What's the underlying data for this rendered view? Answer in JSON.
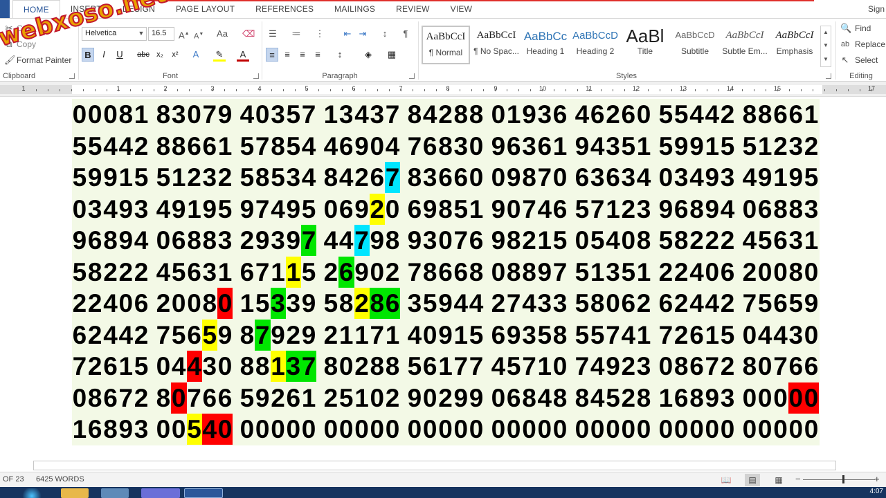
{
  "tabs": [
    "HOME",
    "INSERT",
    "DESIGN",
    "PAGE LAYOUT",
    "REFERENCES",
    "MAILINGS",
    "REVIEW",
    "VIEW"
  ],
  "signin": "Sign",
  "watermark": "webxoso.net",
  "clipboard": {
    "cut": "Cut",
    "copy": "Copy",
    "format_painter": "Format Painter",
    "group_label": "Clipboard"
  },
  "font": {
    "name": "Helvetica",
    "size": "16.5",
    "group_label": "Font"
  },
  "paragraph": {
    "group_label": "Paragraph"
  },
  "styles": {
    "group_label": "Styles",
    "items": [
      {
        "preview": "AaBbCcI",
        "name": "¶ Normal"
      },
      {
        "preview": "AaBbCcI",
        "name": "¶ No Spac..."
      },
      {
        "preview": "AaBbCc",
        "name": "Heading 1"
      },
      {
        "preview": "AaBbCcD",
        "name": "Heading 2"
      },
      {
        "preview": "AaBl",
        "name": "Title"
      },
      {
        "preview": "AaBbCcD",
        "name": "Subtitle"
      },
      {
        "preview": "AaBbCcI",
        "name": "Subtle Em..."
      },
      {
        "preview": "AaBbCcI",
        "name": "Emphasis"
      }
    ]
  },
  "editing": {
    "find": "Find",
    "replace": "Replace",
    "select": "Select",
    "group_label": "Editing"
  },
  "ruler": {
    "labels": [
      "1",
      "1",
      "2",
      "3",
      "4",
      "5",
      "6",
      "7",
      "8",
      "9",
      "10",
      "11",
      "12",
      "13",
      "14",
      "15",
      "17"
    ]
  },
  "document": {
    "rows": [
      [
        "00081",
        "83079",
        "40357",
        "13437",
        "84288",
        "01936",
        "46260",
        "55442",
        "88661"
      ],
      [
        "55442",
        "88661",
        "57854",
        "46904",
        "76830",
        "96361",
        "94351",
        "59915",
        "51232"
      ],
      [
        "59915",
        "51232",
        "58534",
        "84267",
        "83660",
        "09870",
        "63634",
        "03493",
        "49195"
      ],
      [
        "03493",
        "49195",
        "97495",
        "06920",
        "69851",
        "90746",
        "57123",
        "96894",
        "06883"
      ],
      [
        "96894",
        "06883",
        "29397",
        "44798",
        "93076",
        "98215",
        "05408",
        "58222",
        "45631"
      ],
      [
        "58222",
        "45631",
        "67115",
        "26902",
        "78668",
        "08897",
        "51351",
        "22406",
        "20080"
      ],
      [
        "22406",
        "20080",
        "15339",
        "58286",
        "35944",
        "27433",
        "58062",
        "62442",
        "75659"
      ],
      [
        "62442",
        "75659",
        "87929",
        "21171",
        "40915",
        "69358",
        "55741",
        "72615",
        "04430"
      ],
      [
        "72615",
        "04430",
        "88137",
        "80288",
        "56177",
        "45710",
        "74923",
        "08672",
        "80766"
      ],
      [
        "08672",
        "80766",
        "59261",
        "25102",
        "90299",
        "06848",
        "84528",
        "16893",
        "00000"
      ],
      [
        "16893",
        "00540",
        "00000",
        "00000",
        "00000",
        "00000",
        "00000",
        "00000",
        "00000"
      ]
    ],
    "highlights": [
      {
        "row": 2,
        "col": 3,
        "digit": 4,
        "color": "cyan"
      },
      {
        "row": 3,
        "col": 3,
        "digit": 3,
        "color": "yellow"
      },
      {
        "row": 4,
        "col": 2,
        "digit": 4,
        "color": "green"
      },
      {
        "row": 4,
        "col": 3,
        "digit": 2,
        "color": "cyan"
      },
      {
        "row": 5,
        "col": 2,
        "digit": 3,
        "color": "yellow"
      },
      {
        "row": 5,
        "col": 3,
        "digit": 1,
        "color": "green"
      },
      {
        "row": 6,
        "col": 1,
        "digit": 4,
        "color": "red"
      },
      {
        "row": 6,
        "col": 2,
        "digit": 2,
        "color": "green"
      },
      {
        "row": 6,
        "col": 3,
        "digit": 2,
        "color": "yellow"
      },
      {
        "row": 6,
        "col": 3,
        "digit": 3,
        "color": "green"
      },
      {
        "row": 6,
        "col": 3,
        "digit": 4,
        "color": "green"
      },
      {
        "row": 7,
        "col": 1,
        "digit": 3,
        "color": "yellow"
      },
      {
        "row": 7,
        "col": 2,
        "digit": 1,
        "color": "green"
      },
      {
        "row": 8,
        "col": 1,
        "digit": 2,
        "color": "red"
      },
      {
        "row": 8,
        "col": 2,
        "digit": 2,
        "color": "yellow"
      },
      {
        "row": 8,
        "col": 2,
        "digit": 3,
        "color": "green"
      },
      {
        "row": 8,
        "col": 2,
        "digit": 4,
        "color": "green"
      },
      {
        "row": 9,
        "col": 1,
        "digit": 1,
        "color": "red"
      },
      {
        "row": 9,
        "col": 8,
        "digit": 3,
        "color": "red"
      },
      {
        "row": 9,
        "col": 8,
        "digit": 4,
        "color": "red"
      },
      {
        "row": 10,
        "col": 1,
        "digit": 2,
        "color": "yellow"
      },
      {
        "row": 10,
        "col": 1,
        "digit": 3,
        "color": "red"
      },
      {
        "row": 10,
        "col": 1,
        "digit": 4,
        "color": "red"
      }
    ]
  },
  "status": {
    "page": "OF 23",
    "words": "6425 WORDS"
  },
  "clock": "4:07",
  "colors": {
    "accent": "#2b579a",
    "doc_bg": "#f3f9e6",
    "yellow": "#ffff00",
    "green": "#00e600",
    "cyan": "#00e5ff",
    "red": "#ff0000",
    "taskbar": "#16345f"
  }
}
